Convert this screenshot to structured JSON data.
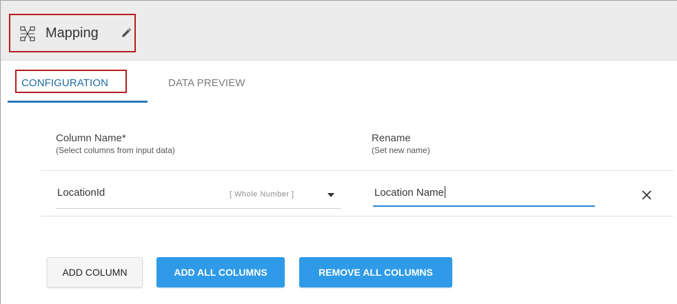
{
  "header": {
    "title": "Mapping",
    "icons": {
      "mapping": "mapping-icon",
      "edit": "pencil-icon"
    }
  },
  "tabs": [
    {
      "label": "CONFIGURATION",
      "active": true
    },
    {
      "label": "DATA PREVIEW",
      "active": false
    }
  ],
  "columns": {
    "name_label": "Column Name*",
    "name_hint": "(Select columns from input data)",
    "rename_label": "Rename",
    "rename_hint": "(Set new name)"
  },
  "rows": [
    {
      "column": "LocationId",
      "type": "[ Whole Number ]",
      "rename": "Location Name"
    }
  ],
  "buttons": {
    "add_column": "ADD COLUMN",
    "add_all": "ADD ALL COLUMNS",
    "remove_all": "REMOVE ALL COLUMNS"
  },
  "colors": {
    "accent": "#2a77b3",
    "primary_button": "#2f9be8",
    "highlight_border": "#b71c1c"
  }
}
